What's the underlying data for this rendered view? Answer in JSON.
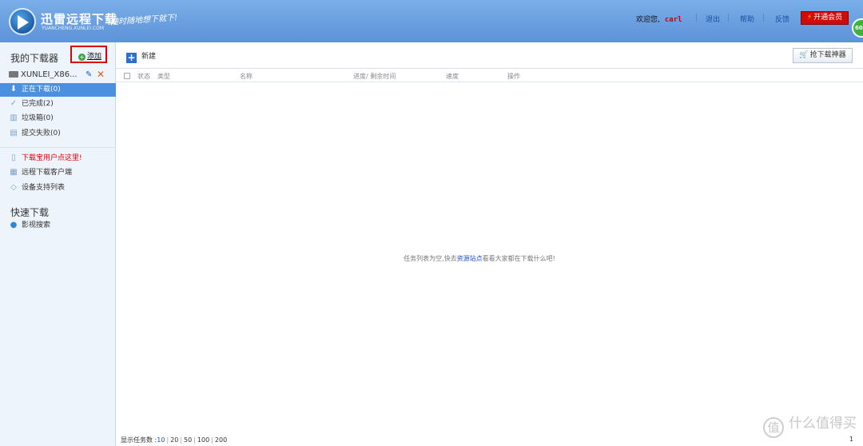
{
  "header": {
    "logo_title": "迅雷远程下载",
    "logo_sub": "YUANCHENG.XUNLEI.COM",
    "slogan": "随时随地想下就下!",
    "welcome": "欢迎您,",
    "username": "carl",
    "links": [
      "退出",
      "帮助",
      "反馈"
    ],
    "vip_button": "开通会员",
    "speed_badge": "60"
  },
  "sidebar": {
    "title": "我的下载器",
    "add_label": "添加",
    "device_name": "XUNLEI_X86...",
    "status_items": [
      {
        "label": "正在下载(0)",
        "icon": "download-arrow-icon"
      },
      {
        "label": "已完成(2)",
        "icon": "check-icon"
      },
      {
        "label": "垃圾箱(0)",
        "icon": "trash-icon"
      },
      {
        "label": "提交失败(0)",
        "icon": "failed-icon"
      }
    ],
    "links": [
      {
        "label": "下载宝用户点这里!",
        "icon": "document-icon"
      },
      {
        "label": "远程下载客户端",
        "icon": "client-icon"
      },
      {
        "label": "设备支持列表",
        "icon": "device-list-icon"
      }
    ],
    "quick_title": "快速下载",
    "quick_items": [
      {
        "label": "影视搜索",
        "icon": "globe-icon"
      }
    ]
  },
  "toolbar": {
    "new_label": "新建",
    "grab_label": "抢下载神器"
  },
  "table": {
    "columns": [
      "状态",
      "类型",
      "名称",
      "进度/ 剩余时间",
      "速度",
      "操作"
    ]
  },
  "empty": {
    "before": "任务列表为空,快去",
    "link": "资源站点",
    "after": "看看大家都在下载什么吧!"
  },
  "footer": {
    "label": "显示任务数 :",
    "options": [
      "10",
      "20",
      "50",
      "100",
      "200"
    ],
    "current_page": "1"
  },
  "watermark": {
    "glyph": "值",
    "text": "什么值得买"
  }
}
